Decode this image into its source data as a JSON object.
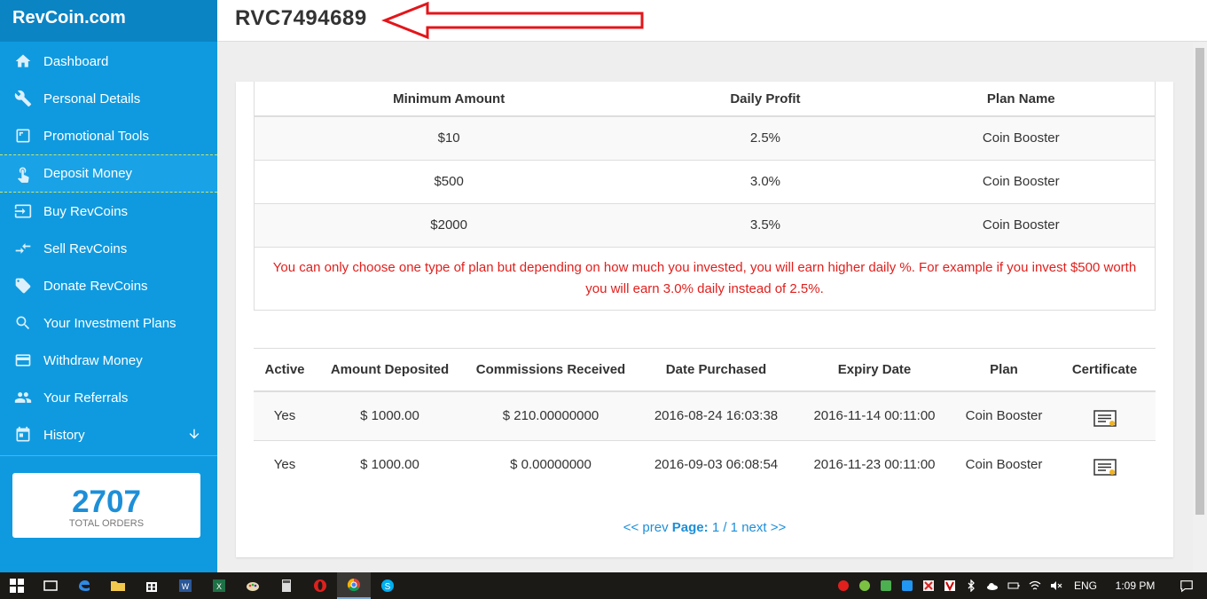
{
  "brand": "RevCoin.com",
  "page_title": "RVC7494689",
  "sidebar": {
    "items": [
      {
        "label": "Dashboard",
        "icon": "home-icon"
      },
      {
        "label": "Personal Details",
        "icon": "wrench-icon"
      },
      {
        "label": "Promotional Tools",
        "icon": "crop-icon"
      },
      {
        "label": "Deposit Money",
        "icon": "hand-pointer-icon",
        "active": true
      },
      {
        "label": "Buy RevCoins",
        "icon": "login-icon"
      },
      {
        "label": "Sell RevCoins",
        "icon": "compare-arrows-icon"
      },
      {
        "label": "Donate RevCoins",
        "icon": "tag-icon"
      },
      {
        "label": "Your Investment Plans",
        "icon": "search-icon"
      },
      {
        "label": "Withdraw Money",
        "icon": "credit-card-icon"
      },
      {
        "label": "Your Referrals",
        "icon": "people-icon"
      },
      {
        "label": "History",
        "icon": "calendar-icon",
        "expandable": true
      }
    ],
    "orders": {
      "count": "2707",
      "label": "TOTAL ORDERS"
    }
  },
  "plans_table": {
    "headers": [
      "Minimum Amount",
      "Daily Profit",
      "Plan Name"
    ],
    "rows": [
      [
        "$10",
        "2.5%",
        "Coin Booster"
      ],
      [
        "$500",
        "3.0%",
        "Coin Booster"
      ],
      [
        "$2000",
        "3.5%",
        "Coin Booster"
      ]
    ],
    "note": "You can only choose one type of plan but depending on how much you invested, you will earn higher daily %. For example if you invest $500 worth you will earn 3.0% daily instead of 2.5%."
  },
  "investments_table": {
    "headers": [
      "Active",
      "Amount Deposited",
      "Commissions Received",
      "Date Purchased",
      "Expiry Date",
      "Plan",
      "Certificate"
    ],
    "rows": [
      [
        "Yes",
        "$ 1000.00",
        "$ 210.00000000",
        "2016-08-24 16:03:38",
        "2016-11-14 00:11:00",
        "Coin Booster"
      ],
      [
        "Yes",
        "$ 1000.00",
        "$ 0.00000000",
        "2016-09-03 06:08:54",
        "2016-11-23 00:11:00",
        "Coin Booster"
      ]
    ]
  },
  "pager": {
    "prev": "<< prev",
    "page_label": "Page:",
    "page_value": "1 / 1",
    "next": "next >>"
  },
  "taskbar": {
    "lang": "ENG",
    "time": "1:09 PM"
  },
  "colors": {
    "sidebar": "#0f9ae0",
    "brand_bar": "#0b84c4",
    "accent": "#1d8fd8",
    "note_red": "#e0201d",
    "annotation_arrow": "#e3151a"
  }
}
